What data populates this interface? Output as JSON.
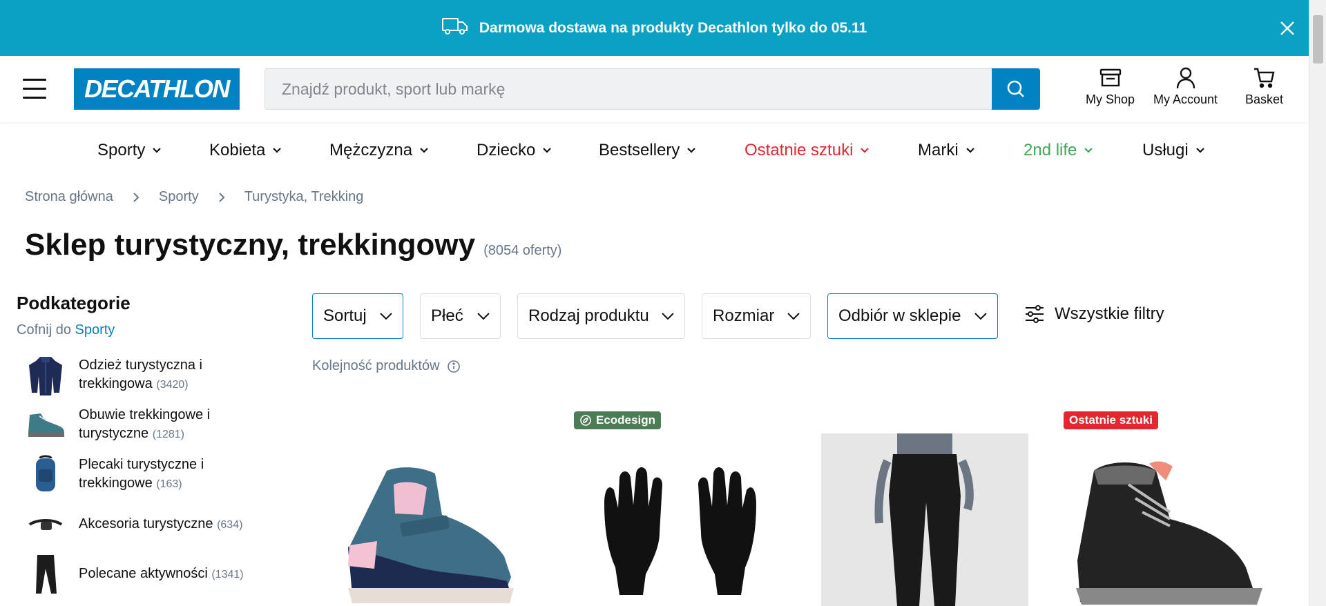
{
  "promo": {
    "text": "Darmowa dostawa na produkty Decathlon tylko do 05.11"
  },
  "header": {
    "logo": "DECATHLON",
    "search_placeholder": "Znajdź produkt, sport lub markę",
    "my_shop": "My Shop",
    "my_account": "My Account",
    "basket": "Basket"
  },
  "nav": {
    "items": [
      {
        "label": "Sporty"
      },
      {
        "label": "Kobieta"
      },
      {
        "label": "Mężczyzna"
      },
      {
        "label": "Dziecko"
      },
      {
        "label": "Bestsellery"
      },
      {
        "label": "Ostatnie sztuki"
      },
      {
        "label": "Marki"
      },
      {
        "label": "2nd life"
      },
      {
        "label": "Usługi"
      }
    ],
    "colors": {
      "red": "#e3262f",
      "green": "#3aa856"
    }
  },
  "breadcrumb": [
    "Strona główna",
    "Sporty",
    "Turystyka, Trekking"
  ],
  "page": {
    "title": "Sklep turystyczny, trekkingowy",
    "offers": "(8054 oferty)"
  },
  "sidebar": {
    "title": "Podkategorie",
    "back_prefix": "Cofnij do",
    "back_link": "Sporty",
    "categories": [
      {
        "line1": "Odzież turystyczna i",
        "line2": "trekkingowa",
        "count": "(3420)",
        "icon": "jacket-icon"
      },
      {
        "line1": "Obuwie trekkingowe i",
        "line2": "turystyczne",
        "count": "(1281)",
        "icon": "hiking-shoe-icon"
      },
      {
        "line1": "Plecaki turystyczne i",
        "line2": "trekkingowe",
        "count": "(163)",
        "icon": "backpack-icon"
      },
      {
        "line1": "Akcesoria turystyczne",
        "count": "(634)",
        "icon": "headlamp-icon"
      },
      {
        "line1": "Polecane aktywności",
        "count": "(1341)",
        "icon": "leggings-icon"
      }
    ]
  },
  "filters": {
    "sort": "Sortuj",
    "gender": "Płeć",
    "product_type": "Rodzaj produktu",
    "size": "Rozmiar",
    "store_pickup": "Odbiór w sklepie",
    "all_filters": "Wszystkie filtry",
    "order_label": "Kolejność produktów"
  },
  "products": [
    {
      "name": "kids-winter-boot",
      "badge": ""
    },
    {
      "name": "gloves",
      "badge": "Ecodesign"
    },
    {
      "name": "trekking-pants",
      "badge": ""
    },
    {
      "name": "snow-boot",
      "badge": "Ostatnie sztuki"
    }
  ],
  "colors": {
    "brand_blue": "#0082c3",
    "banner": "#0aa1c4",
    "eco_badge": "#4b7c55",
    "last_badge": "#e3262f"
  }
}
